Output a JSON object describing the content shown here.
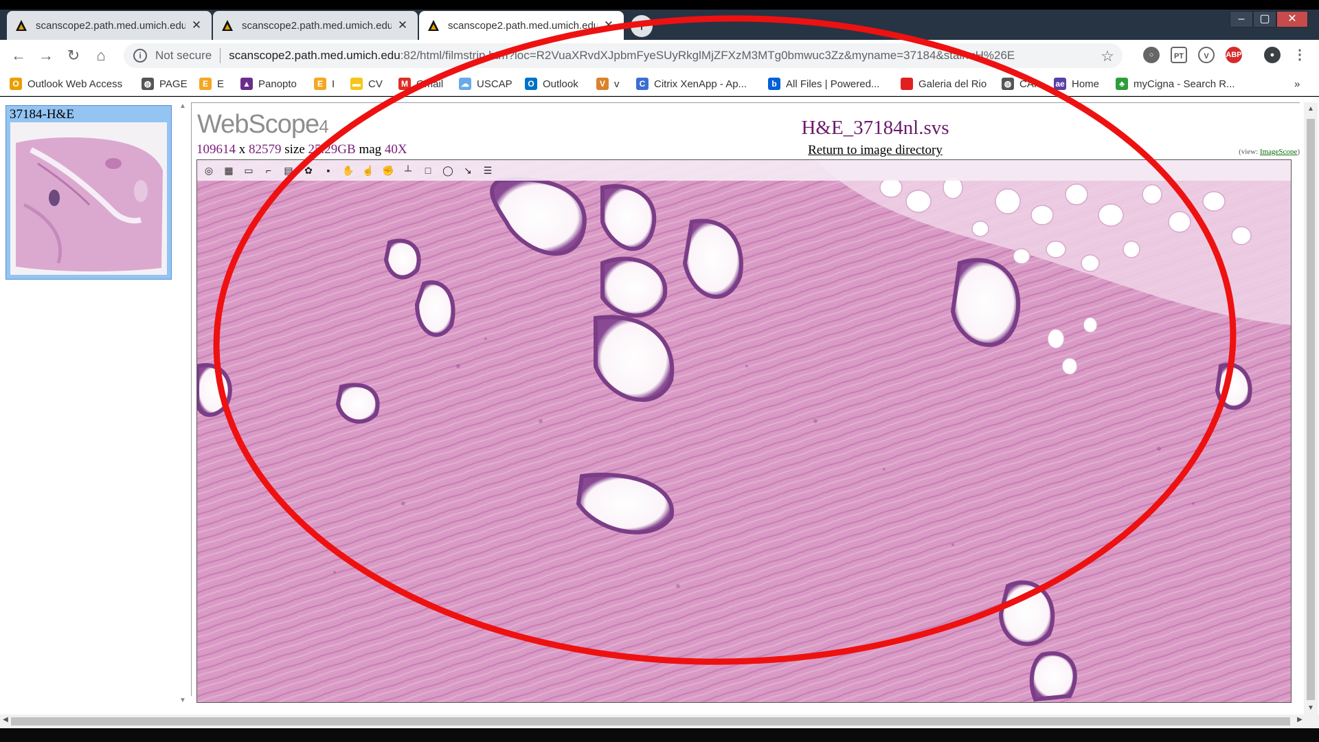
{
  "browser": {
    "tabs": [
      {
        "title": "scanscope2.path.med.umich.edu",
        "active": false
      },
      {
        "title": "scanscope2.path.med.umich.edu",
        "active": false
      },
      {
        "title": "scanscope2.path.med.umich.edu",
        "active": true
      }
    ],
    "address": {
      "security_label": "Not secure",
      "host": "scanscope2.path.med.umich.edu",
      "rest": ":82/html/filmstrip.htm?loc=R2VuaXRvdXJpbmFyeSUyRkglMjZFXzM3MTg0bmwuc3Zz&myname=37184&stain=H%26E"
    },
    "bookmarks": [
      {
        "label": "Outlook Web Access",
        "icon": "outlook-owa-icon",
        "color": "#e8a000"
      },
      {
        "label": "PAGE",
        "icon": "globe-icon",
        "color": "#555555"
      },
      {
        "label": "E",
        "icon": "e-letter-icon",
        "color": "#f5a623"
      },
      {
        "label": "Panopto",
        "icon": "panopto-icon",
        "color": "#6b2d8c"
      },
      {
        "label": "I",
        "icon": "e-letter-icon",
        "color": "#f5a623"
      },
      {
        "label": "CV",
        "icon": "folder-icon",
        "color": "#f5c518"
      },
      {
        "label": "Gmail",
        "icon": "gmail-icon",
        "color": "#d93025"
      },
      {
        "label": "USCAP",
        "icon": "cloud-icon",
        "color": "#6aa9e9"
      },
      {
        "label": "Outlook",
        "icon": "outlook-icon",
        "color": "#0072c6"
      },
      {
        "label": "v",
        "icon": "v-icon",
        "color": "#d9822b"
      },
      {
        "label": "Citrix XenApp - Ap...",
        "icon": "citrix-icon",
        "color": "#3b6fd1"
      },
      {
        "label": "All Files | Powered...",
        "icon": "box-icon",
        "color": "#0061d5"
      },
      {
        "label": "Galeria del Rio",
        "icon": "square-red-icon",
        "color": "#e02020"
      },
      {
        "label": "CAP",
        "icon": "globe-icon",
        "color": "#555555"
      },
      {
        "label": "Home",
        "icon": "ae-icon",
        "color": "#5b3fa6"
      },
      {
        "label": "myCigna - Search R...",
        "icon": "cigna-tree-icon",
        "color": "#2d9d3a"
      }
    ],
    "more_bookmarks": "»"
  },
  "sidebar": {
    "thumbnail_label": "37184-H&E"
  },
  "viewer": {
    "logo_text": "WebScope",
    "logo_version": "4",
    "width_px": "109614",
    "x_sep": "x",
    "height_px": "82579",
    "size_label": "size",
    "size_value": "25.29GB",
    "mag_label": "mag",
    "mag_value": "40X",
    "image_title": "H&E_37184nl.svs",
    "return_link": "Return to image directory",
    "view_prefix": "(view:",
    "view_link": "ImageScope",
    "view_suffix": ")",
    "tools": [
      "navigate-icon",
      "thumbnail-icon",
      "ruler-icon",
      "draw-tool-icon",
      "region-icon",
      "color-palette-icon",
      "save-icon",
      "pan-hand-icon",
      "pointer-icon",
      "zoom-hand-icon",
      "measure-icon",
      "rectangle-icon",
      "ellipse-icon",
      "arrow-icon",
      "annotation-list-icon"
    ]
  },
  "colors": {
    "tissue_pink": "#d98bbb",
    "stroma_pink": "#e6a3c9",
    "nucleus_purple": "#7a3d86",
    "annotation_red": "#ee1111",
    "link_purple": "#7b1e7a"
  }
}
